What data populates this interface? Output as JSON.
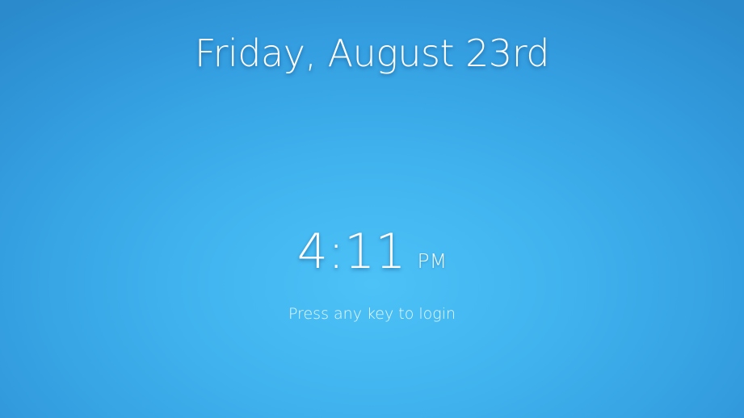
{
  "lock_screen": {
    "date": "Friday, August 23rd",
    "time": "4:11",
    "ampm": "PM",
    "hint": "Press any key to login"
  },
  "colors": {
    "background_center": "#4cc2f7",
    "background_edge": "#2a8acc",
    "text": "#ffffff"
  }
}
